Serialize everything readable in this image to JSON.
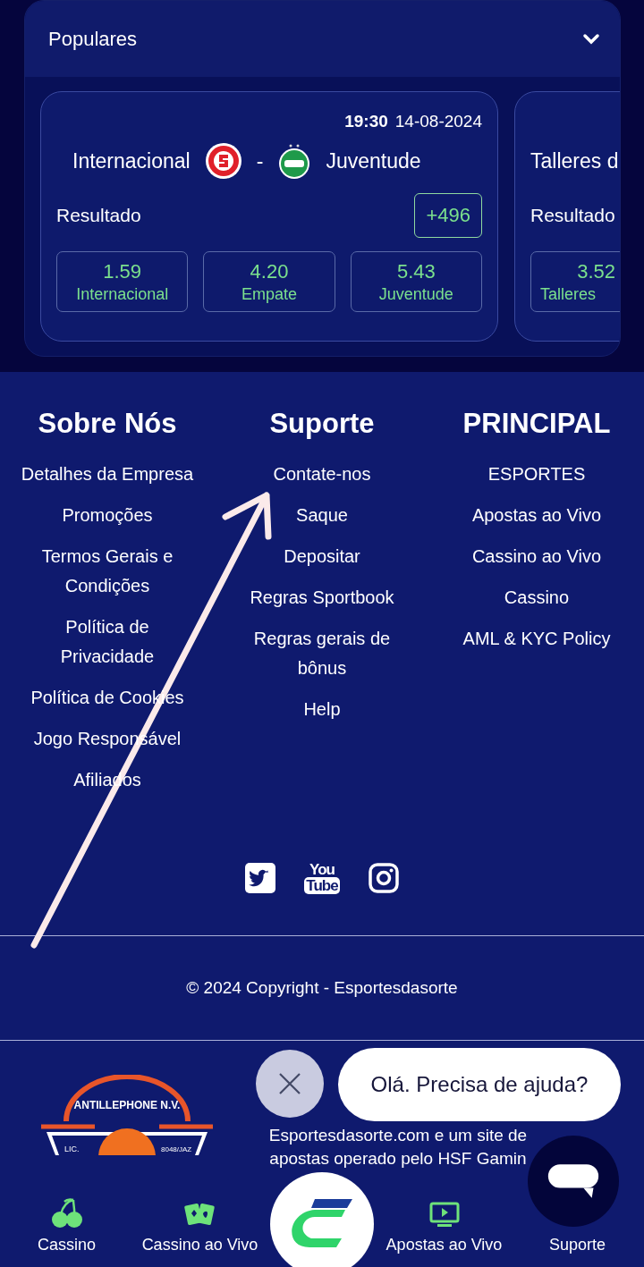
{
  "popular": {
    "title": "Populares",
    "expanded": true,
    "matches": [
      {
        "kind": "full",
        "time": "19:30",
        "date": "14-08-2024",
        "home": "Internacional",
        "separator": "-",
        "away": "Juventude",
        "market": "Resultado",
        "more": "+496",
        "odds": [
          {
            "value": "1.59",
            "label": "Internacional"
          },
          {
            "value": "4.20",
            "label": "Empate"
          },
          {
            "value": "5.43",
            "label": "Juventude"
          }
        ]
      },
      {
        "kind": "partial",
        "home": "Talleres d",
        "market": "Resultado",
        "odds": [
          {
            "value": "3.52",
            "label": "Talleres"
          }
        ]
      }
    ]
  },
  "footer": {
    "columns": [
      {
        "title": "Sobre Nós",
        "links": [
          "Detalhes da Empresa",
          "Promoções",
          "Termos Gerais e Condições",
          "Política de Privacidade",
          "Política de Cookies",
          "Jogo Responsável",
          "Afiliados"
        ]
      },
      {
        "title": "Suporte",
        "links": [
          "Contate-nos",
          "Saque",
          "Depositar",
          "Regras Sportbook",
          "Regras gerais de bônus",
          "Help"
        ]
      },
      {
        "title": "PRINCIPAL",
        "links": [
          "ESPORTES",
          "Apostas ao Vivo",
          "Cassino ao Vivo",
          "Cassino",
          "AML & KYC Policy"
        ]
      }
    ],
    "social": [
      {
        "kind": "twitter"
      },
      {
        "kind": "youtube",
        "top": "You",
        "bottom": "Tube"
      },
      {
        "kind": "instagram"
      }
    ],
    "copyright": "© 2024 Copyright - Esportesdasorte",
    "license_logo": {
      "arc": "ANTILLEPHONE N.V.",
      "left": "LIC.",
      "right": "8048/JAZ"
    },
    "license_text": "Esportesdasorte.com e um site de apostas operado pelo HSF Gamin"
  },
  "chat": {
    "greeting": "Olá. Precisa de ajuda?"
  },
  "bottom_nav": [
    {
      "kind": "cherries",
      "label": "Cassino"
    },
    {
      "kind": "cards",
      "label": "Cassino ao Vivo"
    },
    {
      "kind": "logo"
    },
    {
      "kind": "tv",
      "label": "Apostas ao Vivo"
    },
    {
      "kind": "support",
      "label": "Suporte"
    }
  ]
}
